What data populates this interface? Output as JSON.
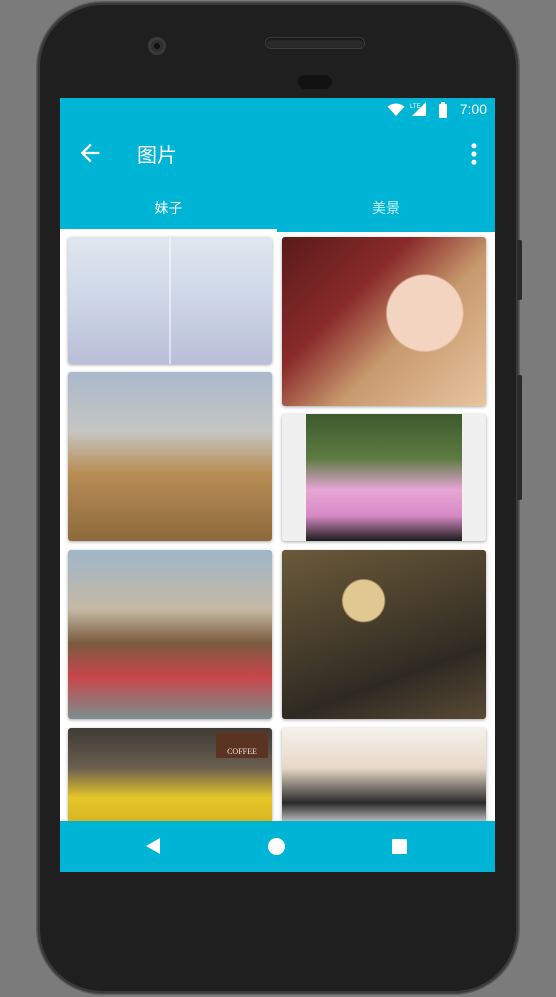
{
  "status_bar": {
    "time": "7:00",
    "network_label": "LTE",
    "icons": [
      "wifi-icon",
      "cell-signal-icon",
      "battery-icon"
    ]
  },
  "app_bar": {
    "title": "图片",
    "back_icon": "arrow-back-icon",
    "overflow_icon": "more-vert-icon"
  },
  "tabs": [
    {
      "label": "妹子",
      "selected": true
    },
    {
      "label": "美景",
      "selected": false
    }
  ],
  "grid": {
    "columns": 2,
    "images": [
      {
        "alt": "woman in lavender outfit, two-panel photo"
      },
      {
        "alt": "laughing woman holding red lobster figurine"
      },
      {
        "alt": "woman in white top standing in golden field"
      },
      {
        "alt": "woman in pink dress beside black convertible"
      },
      {
        "alt": "woman in red striped dress by wooden deck"
      },
      {
        "alt": "classical painting, figure with raised flag"
      },
      {
        "alt": "woman in yellow shirt at cafe terrace"
      },
      {
        "alt": "woman in white cap holding gift box"
      }
    ],
    "cafe_sign_text": "COFFEE"
  },
  "nav_bar": {
    "back_icon": "nav-back-icon",
    "home_icon": "nav-home-icon",
    "recents_icon": "nav-recents-icon"
  },
  "colors": {
    "accent": "#00b4d6",
    "device_body": "#1f1f1f",
    "background": "#7b7b7b"
  }
}
